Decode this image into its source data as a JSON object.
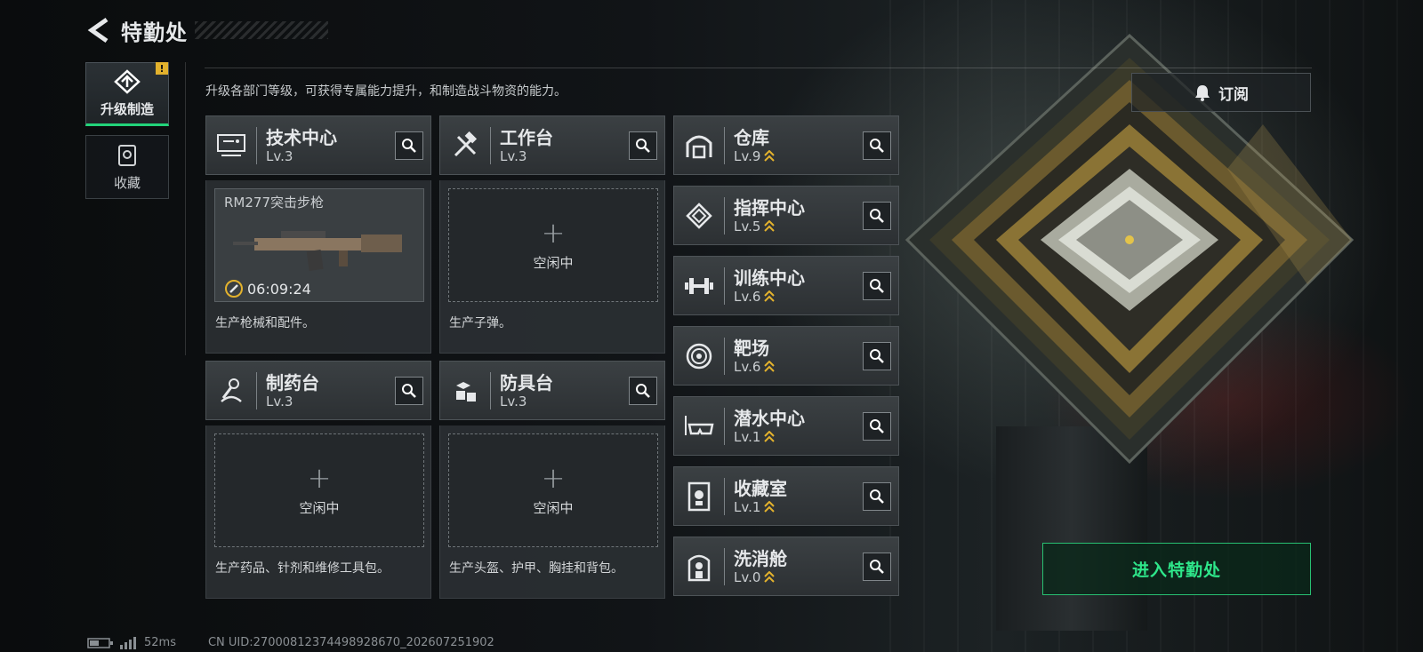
{
  "header": {
    "title": "特勤处"
  },
  "side_nav": [
    {
      "label": "升级制造",
      "active": true,
      "badge": "!"
    },
    {
      "label": "收藏",
      "active": false
    }
  ],
  "subtitle": "升级各部门等级，可获得专属能力提升，和制造战斗物资的能力。",
  "subscribe": {
    "label": "订阅"
  },
  "workshops": [
    {
      "name": "技术中心",
      "level": "Lv.3",
      "icon": "tech-center-icon",
      "slot": {
        "state": "busy",
        "item": "RM277突击步枪",
        "timer": "06:09:24"
      },
      "desc": "生产枪械和配件。"
    },
    {
      "name": "工作台",
      "level": "Lv.3",
      "icon": "workbench-icon",
      "slot": {
        "state": "idle",
        "text": "空闲中"
      },
      "desc": "生产子弹。"
    },
    {
      "name": "制药台",
      "level": "Lv.3",
      "icon": "pharmacy-icon",
      "slot": {
        "state": "idle",
        "text": "空闲中"
      },
      "desc": "生产药品、针剂和维修工具包。"
    },
    {
      "name": "防具台",
      "level": "Lv.3",
      "icon": "armor-bench-icon",
      "slot": {
        "state": "idle",
        "text": "空闲中"
      },
      "desc": "生产头盔、护甲、胸挂和背包。"
    }
  ],
  "facilities": [
    {
      "name": "仓库",
      "level": "Lv.9",
      "icon": "warehouse-icon"
    },
    {
      "name": "指挥中心",
      "level": "Lv.5",
      "icon": "command-center-icon"
    },
    {
      "name": "训练中心",
      "level": "Lv.6",
      "icon": "training-center-icon"
    },
    {
      "name": "靶场",
      "level": "Lv.6",
      "icon": "shooting-range-icon"
    },
    {
      "name": "潜水中心",
      "level": "Lv.1",
      "icon": "diving-center-icon"
    },
    {
      "name": "收藏室",
      "level": "Lv.1",
      "icon": "collection-room-icon"
    },
    {
      "name": "洗消舱",
      "level": "Lv.0",
      "icon": "decon-chamber-icon"
    }
  ],
  "enter": {
    "label": "进入特勤处"
  },
  "footer": {
    "ping": "52ms",
    "uid": "CN UID:27000812374498928670_202607251902"
  },
  "colors": {
    "accent": "#2ee68a",
    "upgrade_chevron": "#e3b22d",
    "alert": "#e3b22d"
  }
}
